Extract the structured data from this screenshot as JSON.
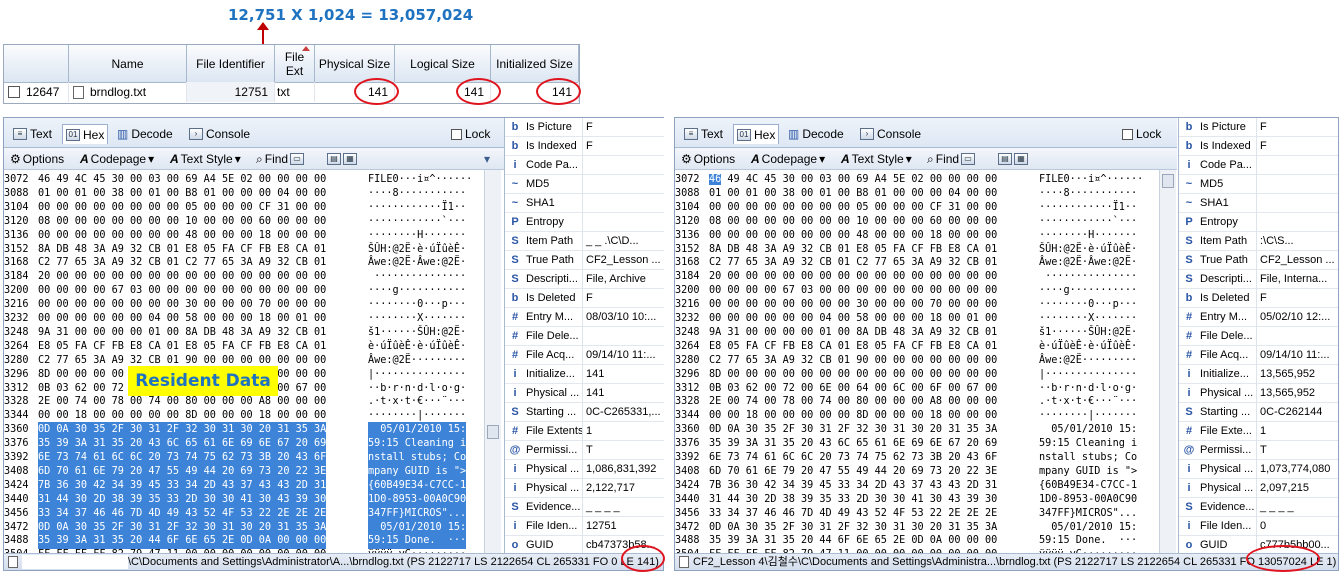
{
  "annotation": {
    "formula": "12,751 X 1,024 = 13,057,024",
    "overlay_label": "Resident Data"
  },
  "grid": {
    "headers": [
      "Name",
      "File Identifier",
      "File Ext",
      "Physical Size",
      "Logical Size",
      "Initialized Size"
    ],
    "row": {
      "id": "12647",
      "name": "brndlog.txt",
      "file_identifier": "12751",
      "ext": "txt",
      "physical": "141",
      "logical": "141",
      "initialized": "141"
    }
  },
  "tabs": [
    "Text",
    "Hex",
    "Decode",
    "Console"
  ],
  "lock_label": "Lock",
  "toolbar": {
    "options": "Options",
    "codepage": "Codepage",
    "text_style": "Text Style",
    "find": "Find"
  },
  "hex_left": [
    [
      "3072",
      "46 49 4C 45 30 00 03 00 69 A4 5E 02 00 00 00 00",
      "FILE0···i¤^······"
    ],
    [
      "3088",
      "01 00 01 00 38 00 01 00 B8 01 00 00 00 04 00 00",
      "····8···········"
    ],
    [
      "3104",
      "00 00 00 00 00 00 00 00 05 00 00 00 CF 31 00 00",
      "············Ï1··"
    ],
    [
      "3120",
      "08 00 00 00 00 00 00 00 10 00 00 00 60 00 00 00",
      "············`···"
    ],
    [
      "3136",
      "00 00 00 00 00 00 00 00 48 00 00 00 18 00 00 00",
      "········H·······"
    ],
    [
      "3152",
      "8A DB 48 3A A9 32 CB 01 E8 05 FA CF FB E8 CA 01",
      "ŠÛH:@2Ë·è·úÏûèÊ·"
    ],
    [
      "3168",
      "C2 77 65 3A A9 32 CB 01 C2 77 65 3A A9 32 CB 01",
      "Âwe:@2Ë·Âwe:@2Ë·"
    ],
    [
      "3184",
      "20 00 00 00 00 00 00 00 00 00 00 00 00 00 00 00",
      " ···············"
    ],
    [
      "3200",
      "00 00 00 00 67 03 00 00 00 00 00 00 00 00 00 00",
      "····g···········"
    ],
    [
      "3216",
      "00 00 00 00 00 00 00 00 30 00 00 00 70 00 00 00",
      "········0···p···"
    ],
    [
      "3232",
      "00 00 00 00 00 00 04 00 58 00 00 00 18 00 01 00",
      "········X·······"
    ],
    [
      "3248",
      "9A 31 00 00 00 00 01 00 8A DB 48 3A A9 32 CB 01",
      "š1······ŠÛH:@2Ë·"
    ],
    [
      "3264",
      "E8 05 FA CF FB E8 CA 01 E8 05 FA CF FB E8 CA 01",
      "è·úÏûèÊ·è·úÏûèÊ·"
    ],
    [
      "3280",
      "C2 77 65 3A A9 32 CB 01 90 00 00 00 00 00 00 00",
      "Âwe:@2Ë·········"
    ],
    [
      "3296",
      "8D 00 00 00 00 00 00 00 00 00 00 00 00 00 00 00",
      "|···············"
    ],
    [
      "3312",
      "0B 03 62 00 72 00 6E 00 64 00 6C 00 6F 00 67 00",
      "··b·r·n·d·l·o·g·"
    ],
    [
      "3328",
      "2E 00 74 00 78 00 74 00 80 00 00 00 A8 00 00 00",
      ".·t·x·t·€···¨···"
    ],
    [
      "3344",
      "00 00 18 00 00 00 00 00 8D 00 00 00 18 00 00 00",
      "········|·······"
    ],
    [
      "3360",
      "0D 0A 30 35 2F 30 31 2F 32 30 31 30 20 31 35 3A",
      "  05/01/2010 15:"
    ],
    [
      "3376",
      "35 39 3A 31 35 20 43 6C 65 61 6E 69 6E 67 20 69",
      "59:15 Cleaning i"
    ],
    [
      "3392",
      "6E 73 74 61 6C 6C 20 73 74 75 62 73 3B 20 43 6F",
      "nstall stubs; Co"
    ],
    [
      "3408",
      "6D 70 61 6E 79 20 47 55 49 44 20 69 73 20 22 3E",
      "mpany GUID is \">"
    ],
    [
      "3424",
      "7B 36 30 42 34 39 45 33 34 2D 43 37 43 43 2D 31",
      "{60B49E34-C7CC-1"
    ],
    [
      "3440",
      "31 44 30 2D 38 39 35 33 2D 30 30 41 30 43 39 30",
      "1D0-8953-00A0C90"
    ],
    [
      "3456",
      "33 34 37 46 46 7D 4D 49 43 52 4F 53 22 2E 2E 2E",
      "347FF}MICROS\"..."
    ],
    [
      "3472",
      "0D 0A 30 35 2F 30 31 2F 32 30 31 30 20 31 35 3A",
      "  05/01/2010 15:"
    ],
    [
      "3488",
      "35 39 3A 31 35 20 44 6F 6E 65 2E 0D 0A 00 00 00",
      "59:15 Done.  ···"
    ],
    [
      "3504",
      "FF FF FF FF 82 79 47 11 00 00 00 00 00 00 00 00",
      "ÿÿÿÿ‚yG·········"
    ]
  ],
  "hex_right": [
    [
      "3072",
      "46 49 4C 45 30 00 03 00 69 A4 5E 02 00 00 00 00",
      "FILE0···i¤^······"
    ],
    [
      "3088",
      "01 00 01 00 38 00 01 00 B8 01 00 00 00 04 00 00",
      "····8···········"
    ],
    [
      "3104",
      "00 00 00 00 00 00 00 00 05 00 00 00 CF 31 00 00",
      "············Ï1··"
    ],
    [
      "3120",
      "08 00 00 00 00 00 00 00 10 00 00 00 60 00 00 00",
      "············`···"
    ],
    [
      "3136",
      "00 00 00 00 00 00 00 00 48 00 00 00 18 00 00 00",
      "········H·······"
    ],
    [
      "3152",
      "8A DB 48 3A A9 32 CB 01 E8 05 FA CF FB E8 CA 01",
      "ŠÛH:@2Ë·è·úÏûèÊ·"
    ],
    [
      "3168",
      "C2 77 65 3A A9 32 CB 01 C2 77 65 3A A9 32 CB 01",
      "Âwe:@2Ë·Âwe:@2Ë·"
    ],
    [
      "3184",
      "20 00 00 00 00 00 00 00 00 00 00 00 00 00 00 00",
      " ···············"
    ],
    [
      "3200",
      "00 00 00 00 67 03 00 00 00 00 00 00 00 00 00 00",
      "····g···········"
    ],
    [
      "3216",
      "00 00 00 00 00 00 00 00 30 00 00 00 70 00 00 00",
      "········0···p···"
    ],
    [
      "3232",
      "00 00 00 00 00 00 04 00 58 00 00 00 18 00 01 00",
      "········X·······"
    ],
    [
      "3248",
      "9A 31 00 00 00 00 01 00 8A DB 48 3A A9 32 CB 01",
      "š1······ŠÛH:@2Ë·"
    ],
    [
      "3264",
      "E8 05 FA CF FB E8 CA 01 E8 05 FA CF FB E8 CA 01",
      "è·úÏûèÊ·è·úÏûèÊ·"
    ],
    [
      "3280",
      "C2 77 65 3A A9 32 CB 01 90 00 00 00 00 00 00 00",
      "Âwe:@2Ë·········"
    ],
    [
      "3296",
      "8D 00 00 00 00 00 00 00 00 00 00 00 00 00 00 00",
      "|···············"
    ],
    [
      "3312",
      "0B 03 62 00 72 00 6E 00 64 00 6C 00 6F 00 67 00",
      "··b·r·n·d·l·o·g·"
    ],
    [
      "3328",
      "2E 00 74 00 78 00 74 00 80 00 00 00 A8 00 00 00",
      ".·t·x·t·€···¨···"
    ],
    [
      "3344",
      "00 00 18 00 00 00 00 00 8D 00 00 00 18 00 00 00",
      "········|·······"
    ],
    [
      "3360",
      "0D 0A 30 35 2F 30 31 2F 32 30 31 30 20 31 35 3A",
      "  05/01/2010 15:"
    ],
    [
      "3376",
      "35 39 3A 31 35 20 43 6C 65 61 6E 69 6E 67 20 69",
      "59:15 Cleaning i"
    ],
    [
      "3392",
      "6E 73 74 61 6C 6C 20 73 74 75 62 73 3B 20 43 6F",
      "nstall stubs; Co"
    ],
    [
      "3408",
      "6D 70 61 6E 79 20 47 55 49 44 20 69 73 20 22 3E",
      "mpany GUID is \">"
    ],
    [
      "3424",
      "7B 36 30 42 34 39 45 33 34 2D 43 37 43 43 2D 31",
      "{60B49E34-C7CC-1"
    ],
    [
      "3440",
      "31 44 30 2D 38 39 35 33 2D 30 30 41 30 43 39 30",
      "1D0-8953-00A0C90"
    ],
    [
      "3456",
      "33 34 37 46 46 7D 4D 49 43 52 4F 53 22 2E 2E 2E",
      "347FF}MICROS\"..."
    ],
    [
      "3472",
      "0D 0A 30 35 2F 30 31 2F 32 30 31 30 20 31 35 3A",
      "  05/01/2010 15:"
    ],
    [
      "3488",
      "35 39 3A 31 35 20 44 6F 6E 65 2E 0D 0A 00 00 00",
      "59:15 Done.  ···"
    ],
    [
      "3504",
      "FF FF FF FF 82 79 47 11 00 00 00 00 00 00 00 00",
      "ÿÿÿÿ‚yG·········"
    ]
  ],
  "props_left": [
    [
      "b",
      "Is Picture",
      "F"
    ],
    [
      "b",
      "Is Indexed",
      "F"
    ],
    [
      "i",
      "Code Pa...",
      ""
    ],
    [
      "~",
      "MD5",
      ""
    ],
    [
      "~",
      "SHA1",
      ""
    ],
    [
      "P",
      "Entropy",
      ""
    ],
    [
      "S",
      "Item Path",
      "_ _ .\\C\\D..."
    ],
    [
      "S",
      "True Path",
      "CF2_Lesson ..."
    ],
    [
      "S",
      "Descripti...",
      "File, Archive"
    ],
    [
      "b",
      "Is Deleted",
      "F"
    ],
    [
      "#",
      "Entry M...",
      "08/03/10 10:..."
    ],
    [
      "#",
      "File Dele...",
      ""
    ],
    [
      "#",
      "File Acq...",
      "09/14/10 11:..."
    ],
    [
      "i",
      "Initialize...",
      "141"
    ],
    [
      "i",
      "Physical ...",
      "141"
    ],
    [
      "S",
      "Starting ...",
      "0C-C265331,..."
    ],
    [
      "#",
      "File Extents",
      "1"
    ],
    [
      "@",
      "Permissi...",
      "T"
    ],
    [
      "i",
      "Physical ...",
      "1,086,831,392"
    ],
    [
      "i",
      "Physical ...",
      "2,122,717"
    ],
    [
      "S",
      "Evidence...",
      "_ _ _ _"
    ],
    [
      "i",
      "File Iden...",
      "12751"
    ],
    [
      "o",
      "GUID",
      "cb47373b58..."
    ]
  ],
  "props_right": [
    [
      "b",
      "Is Picture",
      "F"
    ],
    [
      "b",
      "Is Indexed",
      "F"
    ],
    [
      "i",
      "Code Pa...",
      ""
    ],
    [
      "~",
      "MD5",
      ""
    ],
    [
      "~",
      "SHA1",
      ""
    ],
    [
      "P",
      "Entropy",
      ""
    ],
    [
      "S",
      "Item Path",
      ":\\C\\S..."
    ],
    [
      "S",
      "True Path",
      "CF2_Lesson ..."
    ],
    [
      "S",
      "Descripti...",
      "File, Interna..."
    ],
    [
      "b",
      "Is Deleted",
      "F"
    ],
    [
      "#",
      "Entry M...",
      "05/02/10 12:..."
    ],
    [
      "#",
      "File Dele...",
      ""
    ],
    [
      "#",
      "File Acq...",
      "09/14/10 11:..."
    ],
    [
      "i",
      "Initialize...",
      "13,565,952"
    ],
    [
      "i",
      "Physical ...",
      "13,565,952"
    ],
    [
      "S",
      "Starting ...",
      "0C-C262144"
    ],
    [
      "#",
      "File Exte...",
      "1"
    ],
    [
      "@",
      "Permissi...",
      "T"
    ],
    [
      "i",
      "Physical ...",
      "1,073,774,080"
    ],
    [
      "i",
      "Physical ...",
      "2,097,215"
    ],
    [
      "S",
      "Evidence...",
      "_ _ _ _"
    ],
    [
      "i",
      "File Iden...",
      "0"
    ],
    [
      "o",
      "GUID",
      "c777b5bb00..."
    ]
  ],
  "status_left": "\\C\\Documents and Settings\\Administrator\\A...\\brndlog.txt (PS 2122717  LS 2122654  CL 265331 FO 0 LE 141)",
  "status_right": "CF2_Lesson 4\\김철수\\C\\Documents and Settings\\Administra...\\brndlog.txt (PS 2122717  LS 2122654  CL 265331 FO 13057024 LE 1)",
  "colors": {
    "selection": "#3d84d9",
    "annotation_red": "#e0141e",
    "formula_blue": "#1f72c0",
    "highlight_yellow": "#ffff00"
  }
}
